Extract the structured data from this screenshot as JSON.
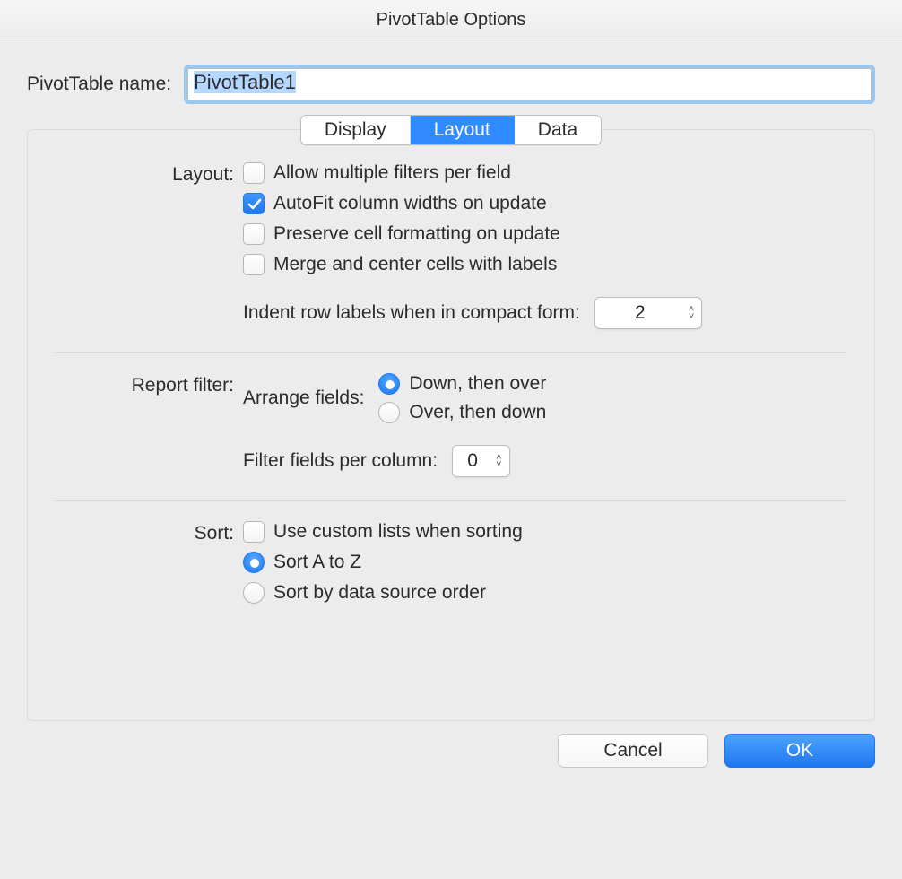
{
  "window": {
    "title": "PivotTable Options"
  },
  "name_field": {
    "label": "PivotTable name:",
    "value": "PivotTable1"
  },
  "tabs": {
    "display": "Display",
    "layout": "Layout",
    "data": "Data",
    "active": "layout"
  },
  "layout_section": {
    "heading": "Layout:",
    "allow_multiple_filters": {
      "label": "Allow multiple filters per field",
      "checked": false
    },
    "autofit_columns": {
      "label": "AutoFit column widths on update",
      "checked": true
    },
    "preserve_formatting": {
      "label": "Preserve cell formatting on update",
      "checked": false
    },
    "merge_center": {
      "label": "Merge and center cells with labels",
      "checked": false
    },
    "indent": {
      "label": "Indent row labels when in compact form:",
      "value": "2"
    }
  },
  "report_filter": {
    "heading": "Report filter:",
    "arrange_label": "Arrange fields:",
    "down_then_over": "Down, then over",
    "over_then_down": "Over, then down",
    "selected": "down_then_over",
    "filter_fields_label": "Filter fields per column:",
    "filter_fields_value": "0"
  },
  "sort_section": {
    "heading": "Sort:",
    "use_custom_lists": {
      "label": "Use custom lists when sorting",
      "checked": false
    },
    "sort_az": "Sort A to Z",
    "sort_source": "Sort by data source order",
    "selected": "sort_az"
  },
  "buttons": {
    "cancel": "Cancel",
    "ok": "OK"
  },
  "colors": {
    "accent": "#1e77f0"
  }
}
